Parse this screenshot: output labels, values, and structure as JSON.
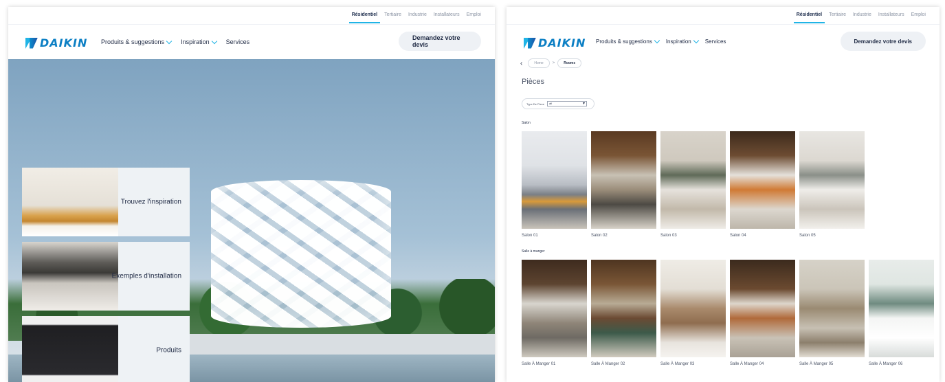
{
  "utility_nav": [
    "Résidentiel",
    "Tertiaire",
    "Industrie",
    "Installateurs",
    "Emploi"
  ],
  "brand": {
    "name": "DAIKIN",
    "accent": "#20b4e6",
    "logo_blue": "#0c7fc4"
  },
  "main_nav": {
    "products": "Produits & suggestions",
    "inspiration": "Inspiration",
    "services": "Services",
    "cta": "Demandez votre devis"
  },
  "hero_tiles": [
    {
      "label": "Trouvez l'inspiration"
    },
    {
      "label": "Exemples d'installation"
    },
    {
      "label": "Produits"
    }
  ],
  "rooms_page": {
    "breadcrumb": [
      "Home",
      "Rooms"
    ],
    "breadcrumb_sep": ">",
    "back_icon": "‹",
    "title": "Pièces",
    "filter_label": "Type De Piece",
    "filter_value": "all",
    "salon": {
      "label": "Salon",
      "items": [
        "Salon 01",
        "Salon 02",
        "Salon 03",
        "Salon 04",
        "Salon 05"
      ]
    },
    "dining": {
      "label": "Salle à manger",
      "items": [
        "Salle À Manger 01",
        "Salle À Manger 02",
        "Salle À Manger 03",
        "Salle À Manger 04",
        "Salle À Manger 05",
        "Salle À Manger 06"
      ]
    }
  }
}
